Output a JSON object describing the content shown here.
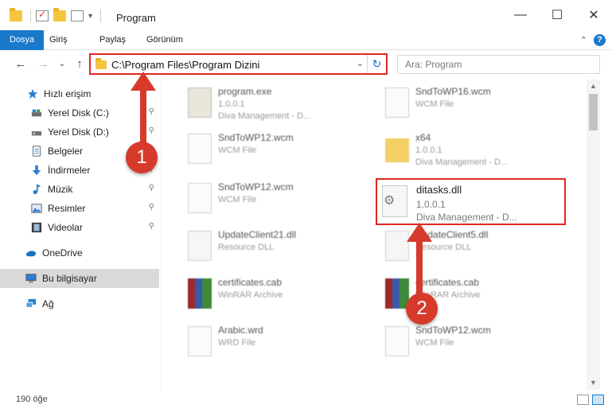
{
  "window": {
    "title": "Program",
    "minimize": "—",
    "maximize": "☐",
    "close": "✕"
  },
  "ribbon": {
    "tabs": [
      "Dosya",
      "Giriş",
      "Paylaş",
      "Görünüm"
    ],
    "help": "?",
    "collapse": "⌃"
  },
  "nav": {
    "back": "←",
    "forward": "→",
    "recent": "⌄",
    "up": "↑",
    "address": "C:\\Program Files\\Program Dizini",
    "address_dropdown": "⌄",
    "refresh": "↻",
    "search_placeholder": "Ara: Program"
  },
  "sidebar": {
    "items": [
      {
        "label": "Hızlı erişim",
        "icon": "star-icon",
        "pinned": false
      },
      {
        "label": "Yerel Disk (C:)",
        "icon": "drive-icon",
        "pinned": true
      },
      {
        "label": "Yerel Disk (D:)",
        "icon": "drive-icon",
        "pinned": true
      },
      {
        "label": "Belgeler",
        "icon": "documents-icon",
        "pinned": true
      },
      {
        "label": "İndirmeler",
        "icon": "download-icon",
        "pinned": true
      },
      {
        "label": "Müzik",
        "icon": "music-icon",
        "pinned": true
      },
      {
        "label": "Resimler",
        "icon": "pictures-icon",
        "pinned": true
      },
      {
        "label": "Videolar",
        "icon": "videos-icon",
        "pinned": true
      },
      {
        "label": "OneDrive",
        "icon": "cloud-icon",
        "pinned": false
      },
      {
        "label": "Bu bilgisayar",
        "icon": "computer-icon",
        "pinned": false
      },
      {
        "label": "Ağ",
        "icon": "network-icon",
        "pinned": false
      }
    ],
    "pin_glyph": "📌"
  },
  "files": [
    {
      "name": "program.exe",
      "meta1": "1.0.0.1",
      "meta2": "Diva Management - D...",
      "type": "exe"
    },
    {
      "name": "SndToWP16.wcm",
      "meta1": "WCM File",
      "meta2": "",
      "type": "file"
    },
    {
      "name": "SndToWP12.wcm",
      "meta1": "WCM File",
      "meta2": "",
      "type": "file"
    },
    {
      "name": "x64",
      "meta1": "1.0.0.1",
      "meta2": "Diva Management - D...",
      "type": "folder"
    },
    {
      "name": "SndToWP12.wcm",
      "meta1": "WCM File",
      "meta2": "",
      "type": "file"
    },
    {
      "name": "UpdateClient21.dll",
      "meta1": "Resource DLL",
      "meta2": "",
      "type": "dll"
    },
    {
      "name": "UpdateClient5.dll",
      "meta1": "Resource DLL",
      "meta2": "",
      "type": "dll"
    },
    {
      "name": "certificates.cab",
      "meta1": "WinRAR Archive",
      "meta2": "",
      "type": "rar"
    },
    {
      "name": "certificates.cab",
      "meta1": "WinRAR Archive",
      "meta2": "",
      "type": "rar"
    },
    {
      "name": "Arabic.wrd",
      "meta1": "WRD File",
      "meta2": "",
      "type": "file"
    },
    {
      "name": "SndToWP12.wcm",
      "meta1": "WCM File",
      "meta2": "",
      "type": "file"
    }
  ],
  "highlighted_file": {
    "name": "ditasks.dll",
    "version": "1.0.0.1",
    "company": "Diva Management - D..."
  },
  "annotations": {
    "badge1": "1",
    "badge2": "2",
    "color": "#d63a2b"
  },
  "status": {
    "count": "190 öğe"
  }
}
